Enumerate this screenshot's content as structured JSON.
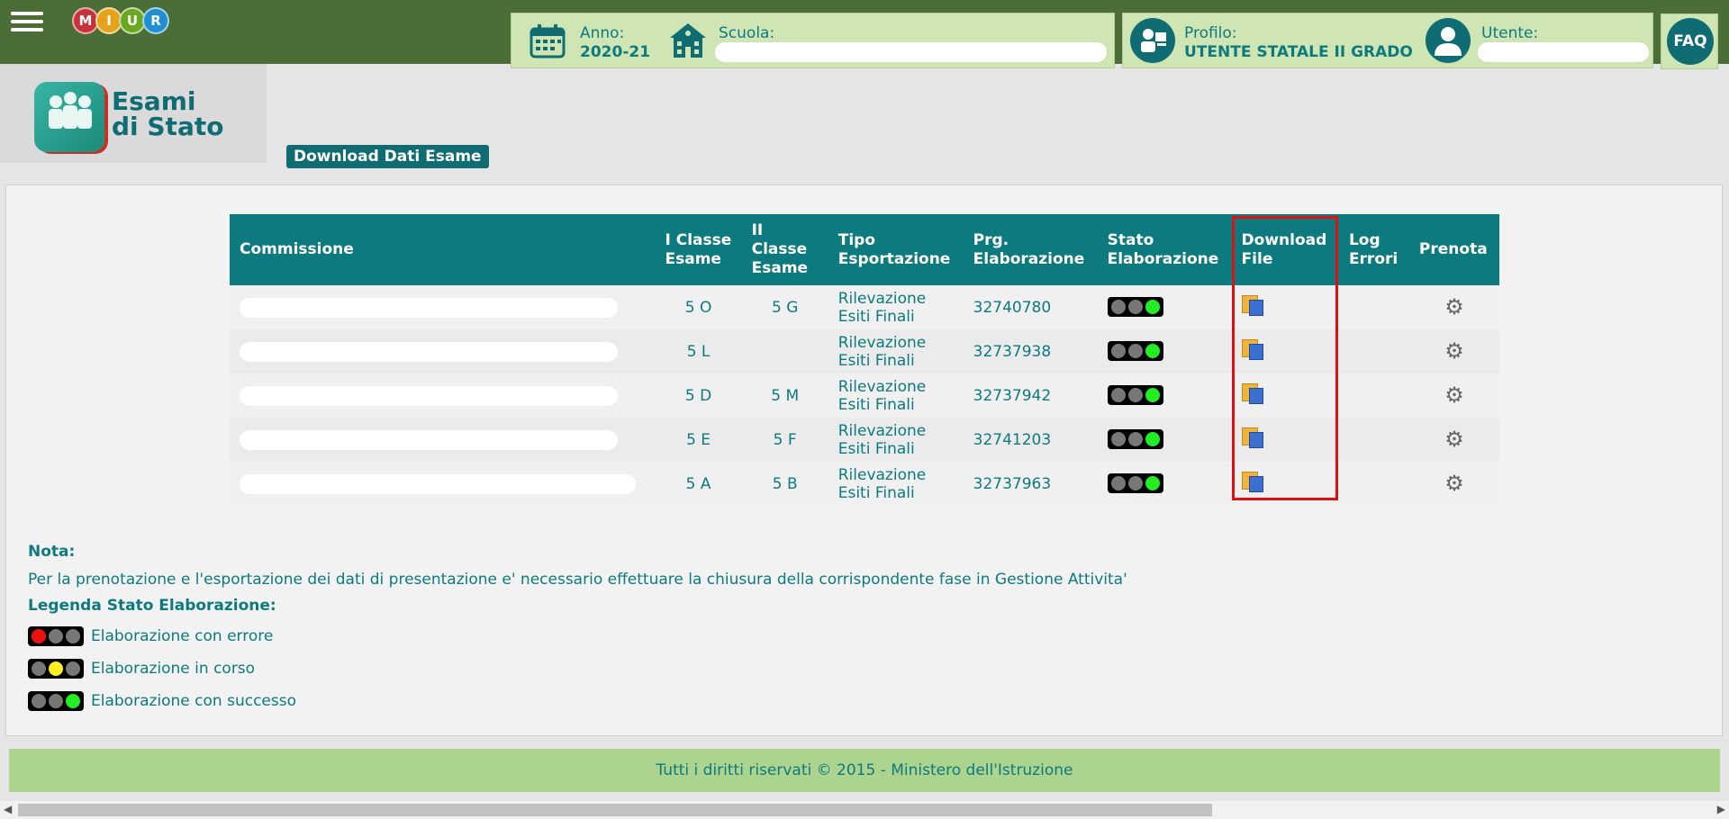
{
  "header": {
    "menu_icon": "hamburger-icon",
    "logo_letters": [
      "M",
      "I",
      "U",
      "R"
    ],
    "logo_colors": [
      "#c8323a",
      "#e6a21a",
      "#6aa821",
      "#1f8fd1"
    ],
    "anno_label": "Anno:",
    "anno_value": "2020-21",
    "scuola_label": "Scuola:",
    "profilo_label": "Profilo:",
    "profilo_value": "UTENTE STATALE II GRADO",
    "utente_label": "Utente:",
    "faq_label": "FAQ"
  },
  "app": {
    "title_line1": "Esami",
    "title_line2": "di Stato",
    "download_button": "Download Dati Esame"
  },
  "table": {
    "headers": {
      "commissione": "Commissione",
      "i_classe": "I Classe Esame",
      "ii_classe": "II Classe Esame",
      "tipo": "Tipo Esportazione",
      "prg": "Prg. Elaborazione",
      "stato": "Stato Elaborazione",
      "download": "Download File",
      "log": "Log Errori",
      "prenota": "Prenota"
    },
    "rows": [
      {
        "i_classe": "5 O",
        "ii_classe": "5 G",
        "tipo": "Rilevazione Esiti Finali",
        "prg": "32740780",
        "stato": "success"
      },
      {
        "i_classe": "5 L",
        "ii_classe": "",
        "tipo": "Rilevazione Esiti Finali",
        "prg": "32737938",
        "stato": "success"
      },
      {
        "i_classe": "5 D",
        "ii_classe": "5 M",
        "tipo": "Rilevazione Esiti Finali",
        "prg": "32737942",
        "stato": "success"
      },
      {
        "i_classe": "5 E",
        "ii_classe": "5 F",
        "tipo": "Rilevazione Esiti Finali",
        "prg": "32741203",
        "stato": "success"
      },
      {
        "i_classe": "5 A",
        "ii_classe": "5 B",
        "tipo": "Rilevazione Esiti Finali",
        "prg": "32737963",
        "stato": "success"
      }
    ]
  },
  "notes": {
    "nota_title": "Nota:",
    "nota_text": "Per la prenotazione e l'esportazione dei dati di presentazione e' necessario effettuare la chiusura della corrispondente fase in Gestione Attivita'",
    "legenda_title": "Legenda Stato Elaborazione:",
    "legenda": [
      {
        "label": "Elaborazione con errore",
        "color": "red"
      },
      {
        "label": "Elaborazione in corso",
        "color": "yellow"
      },
      {
        "label": "Elaborazione con successo",
        "color": "green"
      }
    ]
  },
  "footer": {
    "text": "Tutti i diritti riservati © 2015 -  Ministero dell'Istruzione"
  }
}
